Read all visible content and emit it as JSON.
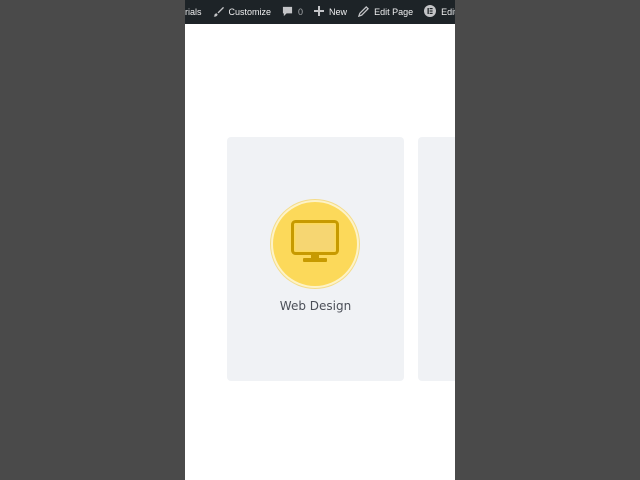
{
  "admin_bar": {
    "items": [
      {
        "label": "rials",
        "icon": "none"
      },
      {
        "label": "Customize",
        "icon": "paintbrush-icon"
      },
      {
        "label": "0",
        "icon": "comment-icon"
      },
      {
        "label": "New",
        "icon": "plus-icon"
      },
      {
        "label": "Edit Page",
        "icon": "pencil-icon"
      },
      {
        "label": "Edit wi",
        "icon": "elementor-icon"
      }
    ]
  },
  "cards": [
    {
      "title": "Web Design",
      "icon": "monitor-icon",
      "icon_color": "#c79a00",
      "circle_color": "#fcd95a"
    }
  ],
  "colors": {
    "admin_bar_bg": "#1d2327",
    "card_bg": "#f0f2f5",
    "page_bg": "#ffffff",
    "outer_bg": "#4a4a4a"
  }
}
